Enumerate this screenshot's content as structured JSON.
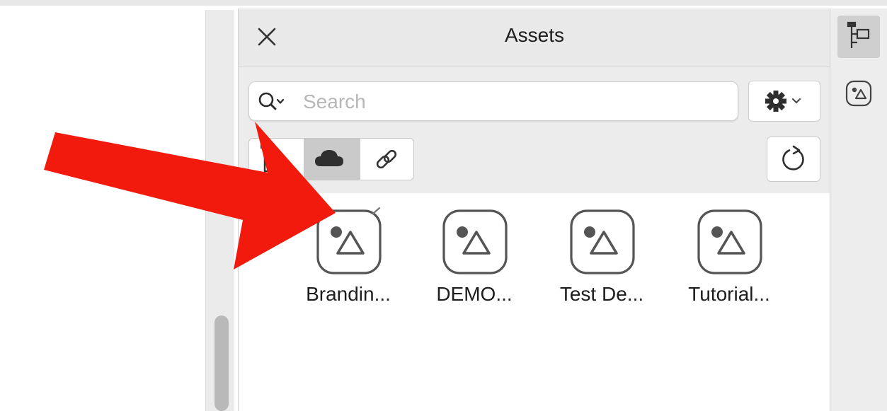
{
  "panel": {
    "title": "Assets"
  },
  "search": {
    "placeholder": "Search",
    "value": ""
  },
  "assets": [
    {
      "label": "Brandin...",
      "linked": true
    },
    {
      "label": "DEMO...",
      "linked": false
    },
    {
      "label": "Test De...",
      "linked": false
    },
    {
      "label": "Tutorial...",
      "linked": false
    }
  ],
  "filter_segments": [
    {
      "name": "libraries",
      "icon": "library-tree-icon",
      "selected": false
    },
    {
      "name": "cloud",
      "icon": "cloud-icon",
      "selected": true
    },
    {
      "name": "linked",
      "icon": "link-icon",
      "selected": false
    }
  ],
  "icons": {
    "close": "close-icon",
    "search": "search-icon",
    "settings": "gear-icon",
    "refresh": "refresh-icon",
    "asset": "asset-library-icon",
    "rail_tree": "layers-tree-icon",
    "rail_assets": "assets-icon"
  },
  "annotation": {
    "color": "#f2190d"
  }
}
